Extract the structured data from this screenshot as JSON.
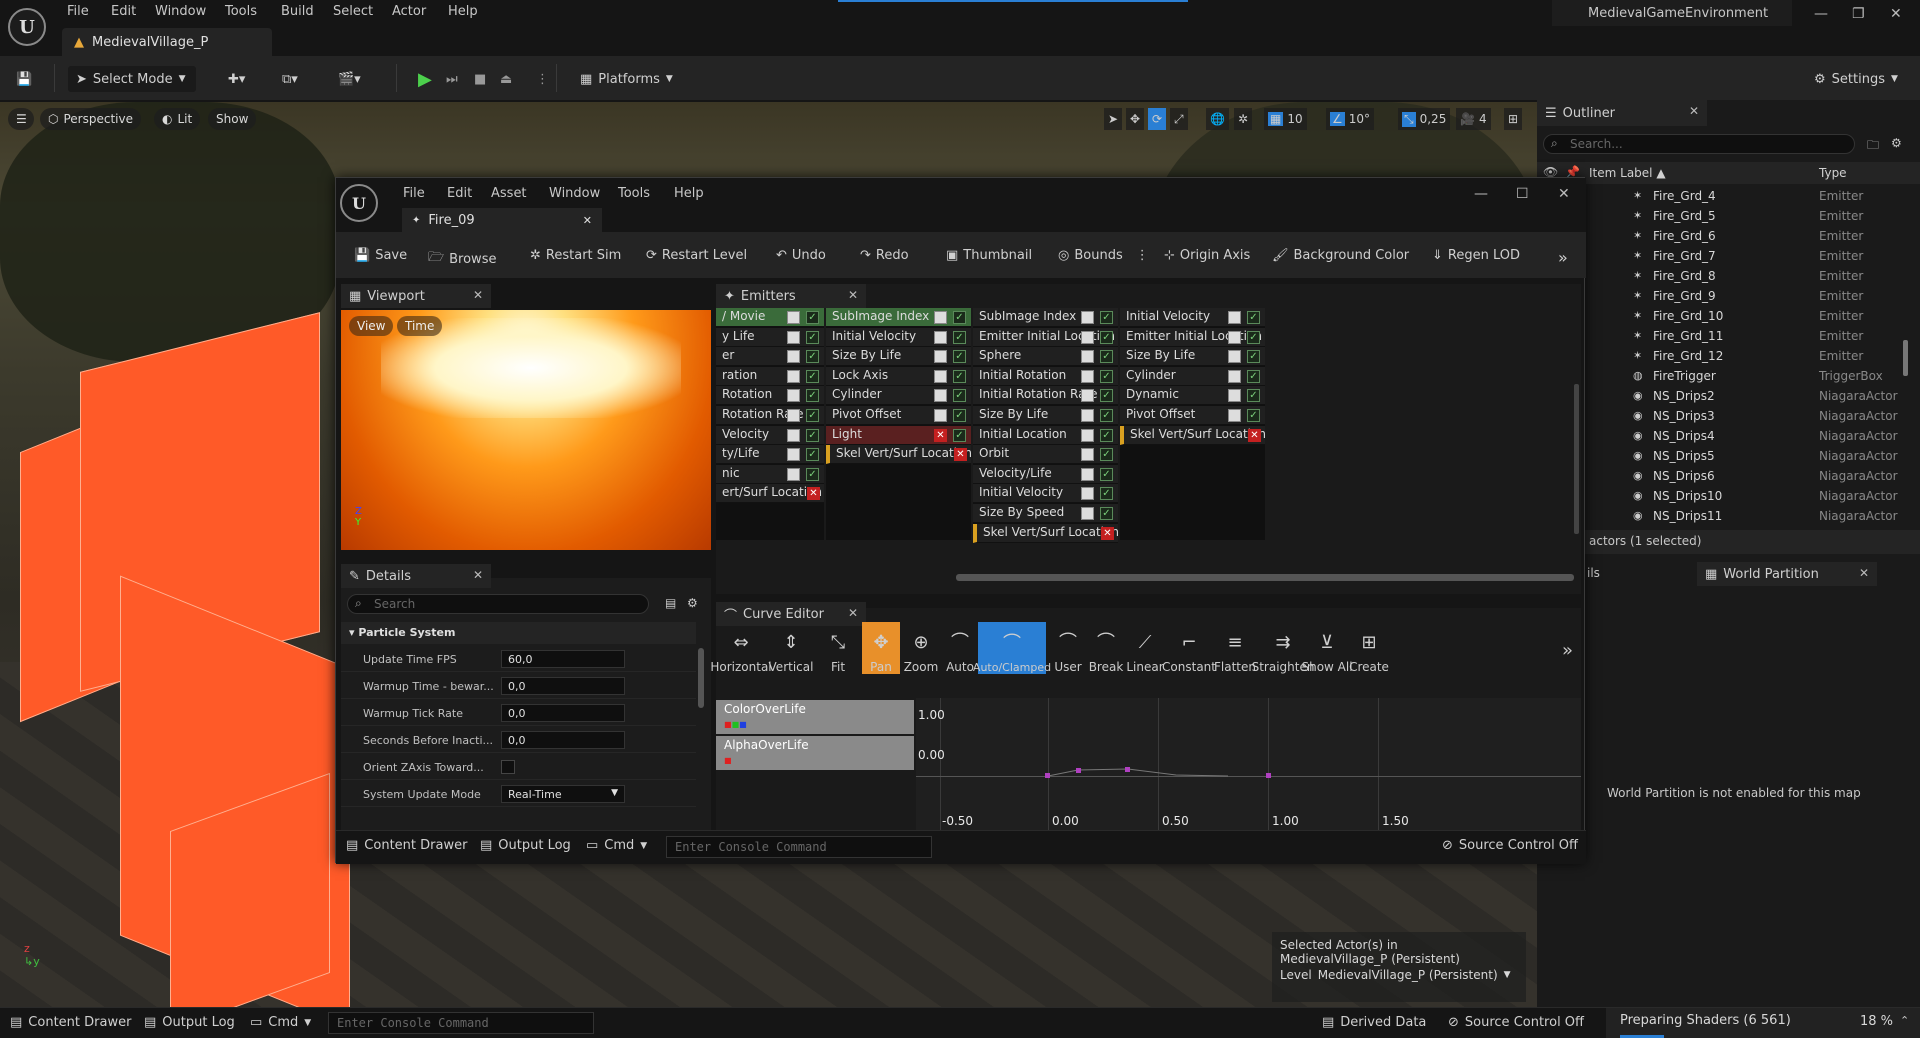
{
  "menubar": {
    "items": [
      "File",
      "Edit",
      "Window",
      "Tools",
      "Build",
      "Select",
      "Actor",
      "Help"
    ],
    "level_tab": "MedievalVillage_P",
    "project_name": "MedievalGameEnvironment"
  },
  "toolbar": {
    "select_mode": "Select Mode",
    "platforms": "Platforms",
    "settings": "Settings"
  },
  "viewport": {
    "perspective": "Perspective",
    "lit": "Lit",
    "show": "Show",
    "grid_value": "10",
    "rotation_snap": "10°",
    "scale_snap": "0,25",
    "camera_speed": "4",
    "selected_info_line1": "Selected Actor(s) in",
    "selected_info_line2": "MedievalVillage_P (Persistent)",
    "level_label": "Level",
    "level_value": "MedievalVillage_P (Persistent)"
  },
  "outliner": {
    "title": "Outliner",
    "search_placeholder": "Search...",
    "col_label": "Item Label ▲",
    "col_type": "Type",
    "rows": [
      {
        "label": "Fire_Grd_4",
        "type": "Emitter"
      },
      {
        "label": "Fire_Grd_5",
        "type": "Emitter"
      },
      {
        "label": "Fire_Grd_6",
        "type": "Emitter"
      },
      {
        "label": "Fire_Grd_7",
        "type": "Emitter"
      },
      {
        "label": "Fire_Grd_8",
        "type": "Emitter"
      },
      {
        "label": "Fire_Grd_9",
        "type": "Emitter"
      },
      {
        "label": "Fire_Grd_10",
        "type": "Emitter"
      },
      {
        "label": "Fire_Grd_11",
        "type": "Emitter"
      },
      {
        "label": "Fire_Grd_12",
        "type": "Emitter"
      },
      {
        "label": "FireTrigger",
        "type": "TriggerBox"
      },
      {
        "label": "NS_Drips2",
        "type": "NiagaraActor"
      },
      {
        "label": "NS_Drips3",
        "type": "NiagaraActor"
      },
      {
        "label": "NS_Drips4",
        "type": "NiagaraActor"
      },
      {
        "label": "NS_Drips5",
        "type": "NiagaraActor"
      },
      {
        "label": "NS_Drips6",
        "type": "NiagaraActor"
      },
      {
        "label": "NS_Drips10",
        "type": "NiagaraActor"
      },
      {
        "label": "NS_Drips11",
        "type": "NiagaraActor"
      }
    ],
    "footer": "actors (1 selected)"
  },
  "world_partition": {
    "tab_left": "ils",
    "tab": "World Partition",
    "message": "World Partition is not enabled for this map"
  },
  "cascade": {
    "menu": [
      "File",
      "Edit",
      "Asset",
      "Window",
      "Tools",
      "Help"
    ],
    "asset_tab": "Fire_09",
    "toolbar": [
      "Save",
      "Browse",
      "Restart Sim",
      "Restart Level",
      "Undo",
      "Redo",
      "Thumbnail",
      "Bounds",
      "Origin Axis",
      "Background Color",
      "Regen LOD"
    ],
    "viewport_tab": "Viewport",
    "view_chip": "View",
    "time_chip": "Time",
    "details_tab": "Details",
    "details_search": "Search",
    "details_section": "Particle System",
    "details_rows": [
      {
        "label": "Update Time FPS",
        "value": "60,0"
      },
      {
        "label": "Warmup Time - bewar...",
        "value": "0,0"
      },
      {
        "label": "Warmup Tick Rate",
        "value": "0,0"
      },
      {
        "label": "Seconds Before Inacti...",
        "value": "0,0"
      },
      {
        "label": "Orient ZAxis Toward...",
        "value": ""
      },
      {
        "label": "System Update Mode",
        "value": "Real-Time"
      }
    ],
    "emitters_tab": "Emitters",
    "emitter_cols": [
      [
        "/ Movie",
        "y Life",
        "er",
        "ration",
        "Rotation",
        "Rotation Rate",
        "Velocity",
        "ty/Life",
        "nic",
        "ert/Surf Location"
      ],
      [
        "SubImage Index",
        "Initial Velocity",
        "Size By Life",
        "Lock Axis",
        "Cylinder",
        "Pivot Offset",
        "Light",
        "Skel Vert/Surf Location"
      ],
      [
        "SubImage Index",
        "Emitter Initial Location",
        "Sphere",
        "Initial Rotation",
        "Initial Rotation Rate",
        "Size By Life",
        "Initial Location",
        "Orbit",
        "Velocity/Life",
        "Initial Velocity",
        "Size By Speed",
        "Skel Vert/Surf Location"
      ],
      [
        "Initial Velocity",
        "Emitter Initial Location",
        "Size By Life",
        "Cylinder",
        "Dynamic",
        "Pivot Offset",
        "Skel Vert/Surf Location"
      ]
    ],
    "curve_tab": "Curve Editor",
    "curve_buttons": [
      "Horizontal",
      "Vertical",
      "Fit",
      "Pan",
      "Zoom",
      "Auto",
      "Auto/Clamped",
      "User",
      "Break",
      "Linear",
      "Constant",
      "Flatten",
      "Straighten",
      "Show All",
      "Create"
    ],
    "tracks": [
      "ColorOverLife",
      "AlphaOverLife"
    ],
    "y_labels": [
      "1.00",
      "0.00"
    ],
    "x_labels": [
      "-0.50",
      "0.00",
      "0.50",
      "1.00",
      "1.50"
    ],
    "status_content": "Content Drawer",
    "status_output": "Output Log",
    "status_cmd": "Cmd",
    "console_placeholder": "Enter Console Command",
    "source_control": "Source Control Off"
  },
  "statusbar": {
    "content_drawer": "Content Drawer",
    "output_log": "Output Log",
    "cmd": "Cmd",
    "console_placeholder": "Enter Console Command",
    "derived_data": "Derived Data",
    "source_control": "Source Control Off",
    "shaders": "Preparing Shaders (6 561)",
    "percent": "18 %"
  },
  "colors": {
    "accent_orange": "#ff5a28",
    "active_button": "#2a7fd4",
    "pan_button": "#e8902a"
  }
}
